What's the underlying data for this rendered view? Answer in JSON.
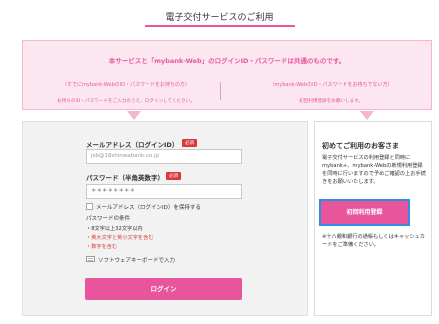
{
  "header": {
    "title": "電子交付サービスのご利用"
  },
  "notice": {
    "headline": "本サービスと「mybank-Web」のログインID・パスワードは共通のものです。",
    "left_sub": "（すでにmybank-WebのID・パスワードをお持ちの方）",
    "left_desc": "お持ちのID・パスワードをご入力のうえ、ログインしてください。",
    "right_sub": "（mybank-WebのID・パスワードをお持ちでない方）",
    "right_desc": "初回利用登録をお願いします。"
  },
  "login": {
    "email_label": "メールアドレス（ログインID）",
    "email_required": "必須",
    "email_value": "jsb@18shinwabank.co.jp",
    "password_label": "パスワード（半角英数字）",
    "password_required": "必須",
    "password_value": "＊＊＊＊＊＊＊＊",
    "remember_label": "メールアドレス（ログインID）を保持する",
    "conditions_title": "パスワードの条件",
    "conditions": [
      "・8文字以上32文字以内",
      "・英大文字と英小文字を含む",
      "・数字を含む"
    ],
    "keyboard_label": "ソフトウェアキーボードで入力",
    "submit_label": "ログイン"
  },
  "guide": {
    "title": "初めてご利用のお客さま",
    "description": "電子交付サービスの利用登録と同時にmybank+、mybank-Webの新規利用登録を同時に行いますので予めご確認の上お手続きをお願いいたします。",
    "register_label": "初回利用登録",
    "note": "※十八親和銀行の通帳もしくはキャッシュカードをご準備ください。"
  },
  "colors": {
    "accent": "#e8559d",
    "notice_bg": "#fce7f1",
    "required": "#d83a3a",
    "focus_border": "#2f8ee0"
  }
}
